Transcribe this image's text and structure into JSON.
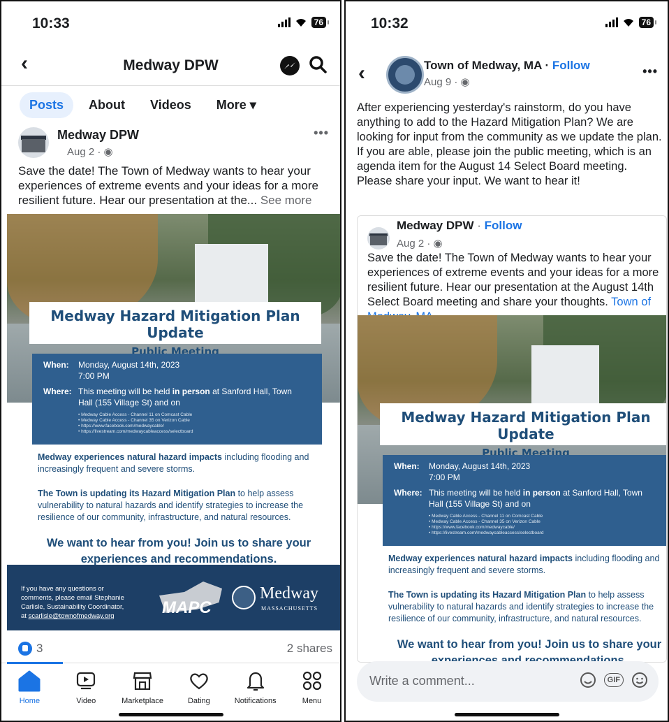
{
  "left": {
    "status": {
      "time": "10:33",
      "battery": "76"
    },
    "header": {
      "title": "Medway DPW"
    },
    "tabs": [
      {
        "label": "Posts"
      },
      {
        "label": "About"
      },
      {
        "label": "Videos"
      },
      {
        "label": "More ▾"
      }
    ],
    "post": {
      "author": "Medway DPW",
      "meta": "Aug 2 · ",
      "text": "Save the date! The Town of Medway wants to hear your experiences of extreme events and your ideas for a more resilient future. Hear our presentation at the...",
      "see_more": "See more",
      "reactions_count": "3",
      "shares": "2 shares"
    },
    "bottom_nav": [
      {
        "label": "Home",
        "icon": "home-icon"
      },
      {
        "label": "Video",
        "icon": "video-icon"
      },
      {
        "label": "Marketplace",
        "icon": "marketplace-icon"
      },
      {
        "label": "Dating",
        "icon": "dating-icon"
      },
      {
        "label": "Notifications",
        "icon": "bell-icon"
      },
      {
        "label": "Menu",
        "icon": "menu-icon"
      }
    ]
  },
  "poster": {
    "title": "Medway Hazard Mitigation Plan Update",
    "subtitle": "Public Meeting",
    "when_label": "When:",
    "when_value_1": "Monday, August 14th, 2023",
    "when_value_2": "7:00 PM",
    "where_label": "Where:",
    "where_pre": "This meeting will be held ",
    "where_bold": "in person",
    "where_post": " at Sanford Hall, Town",
    "where_line2": "Hall (155 Village St) and on",
    "bullets": [
      "• Medway Cable Access - Channel 11 on Comcast Cable",
      "• Medway Cable Access - Channel 35 on Verizon Cable",
      "• https://www.facebook.com/medwaycable/",
      "• https://livestream.com/medwaycableaccess/selectboard"
    ],
    "p1_bold": "Medway experiences natural hazard impacts",
    "p1_rest": " including flooding and increasingly frequent and severe storms.",
    "p2_bold": "The Town is updating its Hazard Mitigation Plan",
    "p2_rest": " to help assess vulnerability to natural hazards and identify strategies to increase the resilience of our community, infrastructure, and natural resources.",
    "cta": "We want to hear from you! Join us to share your experiences and recommendations.",
    "footer_text_1": "If you have any questions or",
    "footer_text_2": "comments, please email Stephanie",
    "footer_text_3": "Carlisle, Sustainability Coordinator,",
    "footer_text_4": "at ",
    "footer_email": "scarlisle@townofmedway.org",
    "mapc": "MAPC",
    "medway_logo": "Medway",
    "mass_logo": "MASSACHUSETTS"
  },
  "right": {
    "status": {
      "time": "10:32",
      "battery": "76"
    },
    "header": {
      "name": "Town of Medway, MA",
      "sep": " · ",
      "follow": "Follow",
      "meta": "Aug 9 · "
    },
    "post_text": "After experiencing yesterday's rainstorm, do you have anything to add to the Hazard Mitigation Plan? We are looking for input from the community as we update the plan. If you are able, please join the public meeting, which is an agenda item for the August 14 Select Board meeting. Please share your input. We want to hear it!",
    "shared": {
      "author": "Medway DPW",
      "sep": " · ",
      "follow": "Follow",
      "meta": "Aug 2 · ",
      "text": "Save the date! The Town of Medway wants to hear your experiences of extreme events and your ideas for a more resilient future. Hear our presentation at the August 14th  Select Board meeting and share your thoughts. ",
      "tag": "Town of Medway, MA"
    },
    "composer": {
      "placeholder": "Write a comment...",
      "gif": "GIF"
    }
  },
  "colors": {
    "accent": "#1b74e4",
    "poster_blue": "#2f5f8f",
    "poster_navy": "#1d3f66"
  }
}
